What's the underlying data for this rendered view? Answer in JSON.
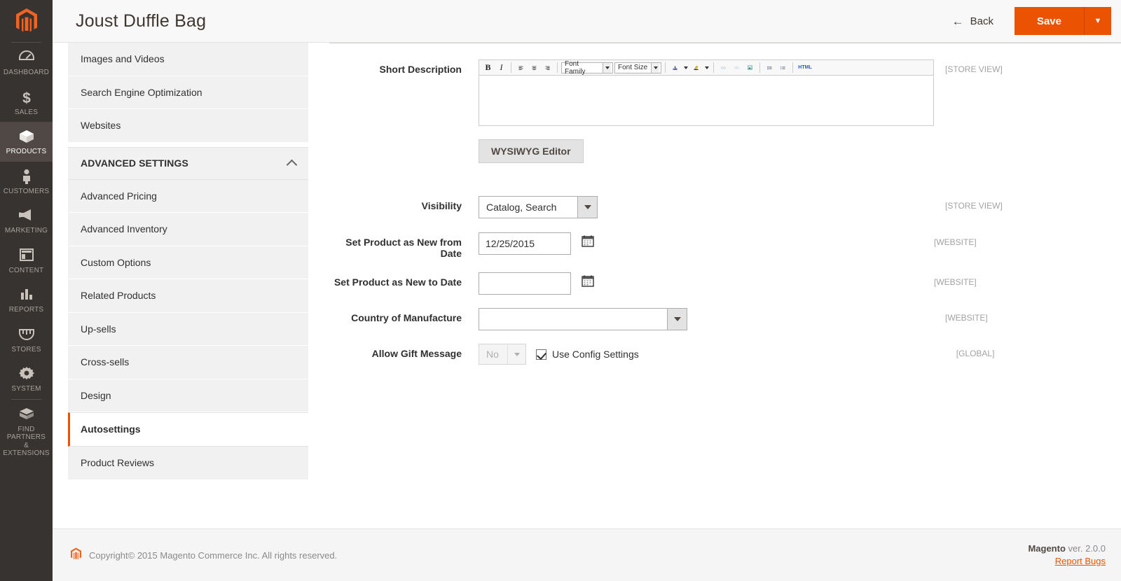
{
  "brand": {
    "accent": "#eb5202",
    "rail_bg": "#373330",
    "rail_active_bg": "#4f4845"
  },
  "rail": {
    "logo_icon": "magento-logo-icon",
    "items": [
      {
        "label": "Dashboard",
        "icon": "dashboard-icon",
        "active": false
      },
      {
        "label": "Sales",
        "icon": "sales-dollar-icon",
        "active": false
      },
      {
        "label": "Products",
        "icon": "products-box-icon",
        "active": true
      },
      {
        "label": "Customers",
        "icon": "customers-person-icon",
        "active": false
      },
      {
        "label": "Marketing",
        "icon": "marketing-megaphone-icon",
        "active": false
      },
      {
        "label": "Content",
        "icon": "content-layout-icon",
        "active": false
      },
      {
        "label": "Reports",
        "icon": "reports-bars-icon",
        "active": false
      },
      {
        "label": "Stores",
        "icon": "stores-awning-icon",
        "active": false
      },
      {
        "label": "System",
        "icon": "system-gear-icon",
        "active": false
      },
      {
        "label": "Find Partners\n& Extensions",
        "icon": "partners-box-icon",
        "active": false
      }
    ]
  },
  "header": {
    "title": "Joust Duffle Bag",
    "back_label": "Back",
    "back_icon": "arrow-left-icon",
    "save_label": "Save",
    "save_caret_icon": "chevron-down-icon"
  },
  "product_nav": {
    "items": [
      {
        "label": "Images and Videos",
        "type": "item",
        "active": false
      },
      {
        "label": "Search Engine Optimization",
        "type": "item",
        "active": false
      },
      {
        "label": "Websites",
        "type": "item",
        "active": false
      }
    ],
    "section": {
      "label": "Advanced Settings",
      "collapse_icon": "chevron-up-icon",
      "expanded": true
    },
    "section_items": [
      {
        "label": "Advanced Pricing",
        "active": false
      },
      {
        "label": "Advanced Inventory",
        "active": false
      },
      {
        "label": "Custom Options",
        "active": false
      },
      {
        "label": "Related Products",
        "active": false
      },
      {
        "label": "Up-sells",
        "active": false
      },
      {
        "label": "Cross-sells",
        "active": false
      },
      {
        "label": "Design",
        "active": false
      },
      {
        "label": "Autosettings",
        "active": true
      },
      {
        "label": "Product Reviews",
        "active": false
      }
    ]
  },
  "form": {
    "short_description": {
      "label": "Short Description",
      "scope": "[STORE VIEW]",
      "value": "",
      "toolbar": {
        "bold": "B",
        "italic": "I",
        "align_left_icon": "align-left-icon",
        "align_center_icon": "align-center-icon",
        "align_right_icon": "align-right-icon",
        "font_family": "Font Family",
        "font_size": "Font Size",
        "text_color_icon": "text-color-icon",
        "highlight_icon": "text-highlight-icon",
        "link_icon": "insert-link-icon",
        "unlink_icon": "unlink-icon",
        "image_icon": "insert-image-icon",
        "bullet_list_icon": "bullet-list-icon",
        "numbered_list_icon": "numbered-list-icon",
        "html_label": "HTML"
      },
      "toggle_button": "WYSIWYG Editor"
    },
    "visibility": {
      "label": "Visibility",
      "value": "Catalog, Search",
      "scope": "[STORE VIEW]",
      "caret_icon": "chevron-down-icon"
    },
    "new_from_date": {
      "label": "Set Product as New from Date",
      "value": "12/25/2015",
      "scope": "[WEBSITE]",
      "calendar_icon": "calendar-icon"
    },
    "new_to_date": {
      "label": "Set Product as New to Date",
      "value": "",
      "scope": "[WEBSITE]",
      "calendar_icon": "calendar-icon"
    },
    "country_of_manufacture": {
      "label": "Country of Manufacture",
      "value": "",
      "scope": "[WEBSITE]",
      "caret_icon": "chevron-down-icon"
    },
    "allow_gift_message": {
      "label": "Allow Gift Message",
      "value": "No",
      "scope": "[GLOBAL]",
      "checkbox_label": "Use Config Settings",
      "checkbox_checked": true,
      "disabled": true,
      "caret_icon": "chevron-down-icon"
    }
  },
  "footer": {
    "logo_icon": "magento-logo-icon",
    "copyright": "Copyright© 2015 Magento Commerce Inc. All rights reserved.",
    "version_brand": "Magento",
    "version_text": " ver. 2.0.0",
    "report_bugs": "Report Bugs"
  }
}
